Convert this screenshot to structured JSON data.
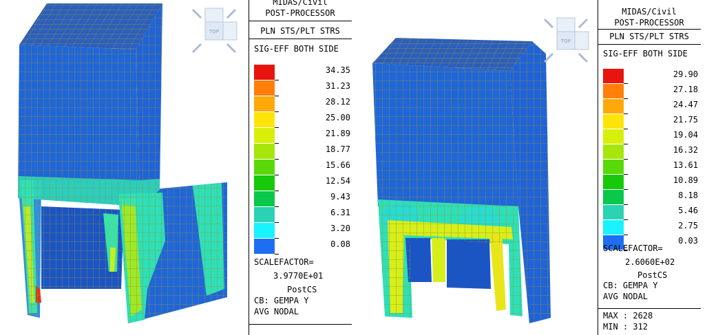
{
  "scale_colors": [
    "#e8140f",
    "#ff7f0a",
    "#ffa80a",
    "#ffe40a",
    "#d8ef0a",
    "#a6e60a",
    "#5ad90a",
    "#18c80a",
    "#0ac84a",
    "#2ad3b4",
    "#19f2ff",
    "#1e6ef2"
  ],
  "left": {
    "title": "MIDAS/Civil",
    "subtitle": "POST-PROCESSOR",
    "type": "PLN STS/PLT STRS",
    "component": "SIG-EFF BOTH SIDE",
    "values": [
      "34.35",
      "31.23",
      "28.12",
      "25.00",
      "21.89",
      "18.77",
      "15.66",
      "12.54",
      "9.43",
      "6.31",
      "3.20",
      "0.08"
    ],
    "scalefactor_label": "SCALEFACTOR=",
    "scalefactor_value": "3.9770E+01",
    "stage": "PostCS",
    "load_case": "CB: GEMPA Y",
    "nodal": "AVG NODAL"
  },
  "right": {
    "title": "MIDAS/Civil",
    "subtitle": "POST-PROCESSOR",
    "type": "PLN STS/PLT STRS",
    "component": "SIG-EFF BOTH SIDE",
    "values": [
      "29.90",
      "27.18",
      "24.47",
      "21.75",
      "19.04",
      "16.32",
      "13.61",
      "10.89",
      "8.18",
      "5.46",
      "2.75",
      "0.03"
    ],
    "scalefactor_label": "SCALEFACTOR=",
    "scalefactor_value": "2.6060E+02",
    "stage": "PostCS",
    "load_case": "CB: GEMPA Y",
    "nodal": "AVG NODAL",
    "max": "MAX : 2628",
    "min": "MIN : 312"
  },
  "viewcube_label": "TOP"
}
